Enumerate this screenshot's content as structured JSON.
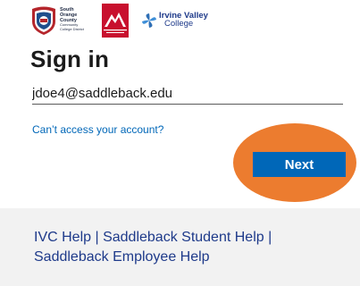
{
  "logos": {
    "socccd": {
      "line1": "South",
      "line2": "Orange",
      "line3": "County",
      "sub1": "Community",
      "sub2": "College District"
    },
    "saddleback": {
      "label": "SADDLEBACK COLLEGE"
    },
    "ivc": {
      "line1": "Irvine Valley",
      "line2": "College"
    }
  },
  "page": {
    "title": "Sign in",
    "email_value": "jdoe4@saddleback.edu",
    "cant_access_link": "Can’t access your account?",
    "next_label": "Next"
  },
  "help": {
    "ivc_help": "IVC Help",
    "sep1": " | ",
    "student_help": "Saddleback Student Help",
    "sep2": " | ",
    "employee_help": "Saddleback Employee Help"
  },
  "colors": {
    "accent": "#0067b8",
    "highlight": "#ec7c2f",
    "help_bg": "#f2f2f2"
  }
}
